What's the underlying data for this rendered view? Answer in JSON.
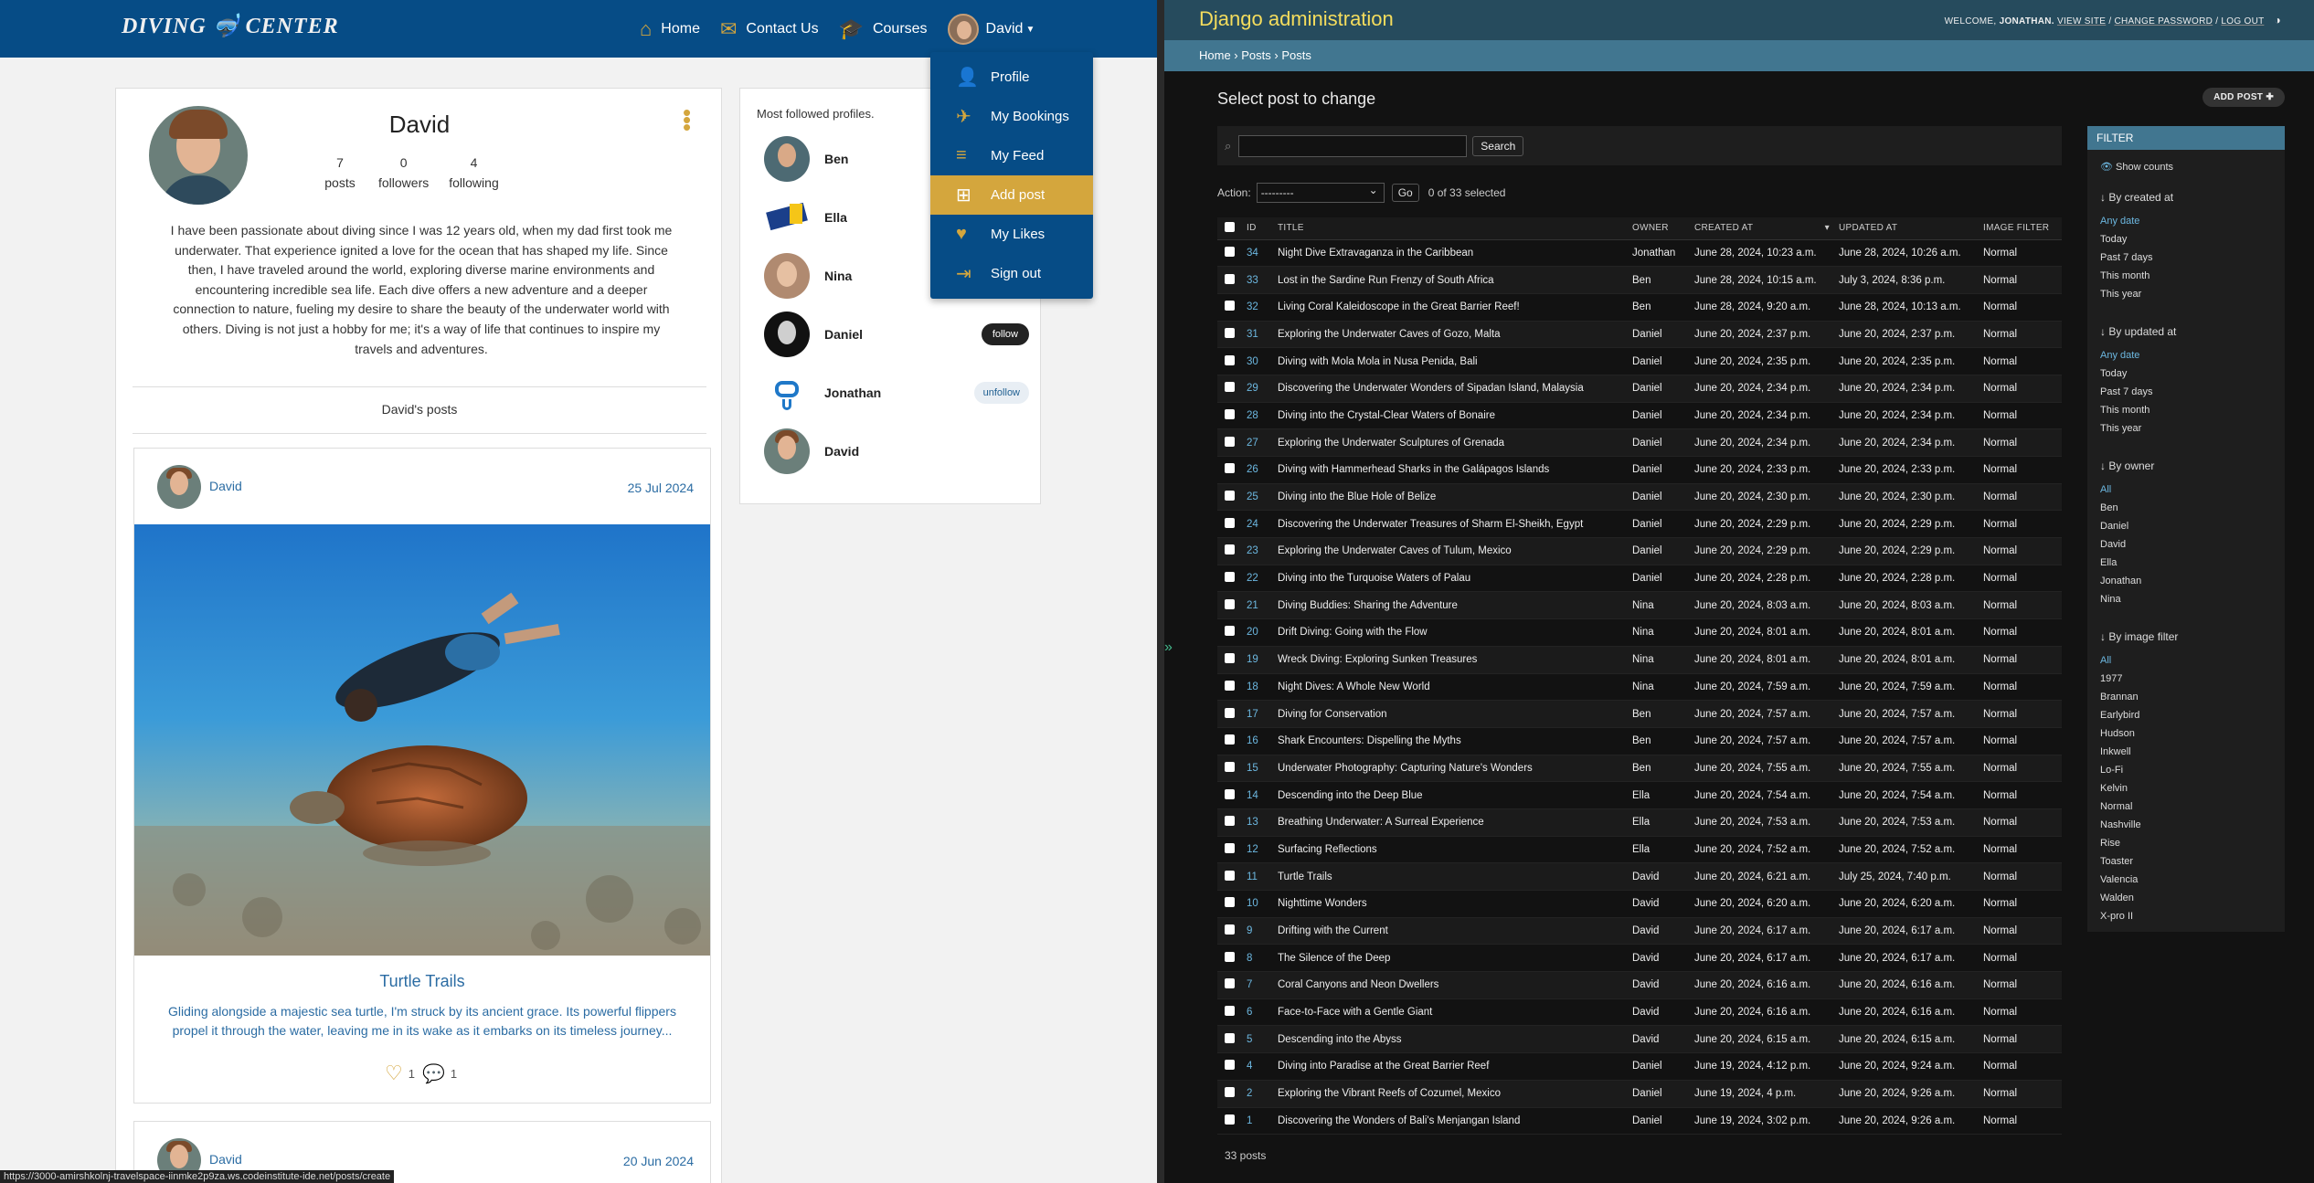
{
  "site": {
    "logo_left": "DIVING",
    "logo_right": "CENTER",
    "nav": [
      {
        "label": "Home",
        "icon": "home-icon"
      },
      {
        "label": "Contact Us",
        "icon": "envelope-icon"
      },
      {
        "label": "Courses",
        "icon": "graduation-cap-icon"
      }
    ],
    "user_label": "David",
    "dropdown": [
      {
        "label": "Profile",
        "icon": "user-icon"
      },
      {
        "label": "My Bookings",
        "icon": "plane-icon"
      },
      {
        "label": "My Feed",
        "icon": "feed-icon"
      },
      {
        "label": "Add post",
        "icon": "plus-square-icon"
      },
      {
        "label": "My Likes",
        "icon": "heart-icon"
      },
      {
        "label": "Sign out",
        "icon": "sign-out-icon"
      }
    ]
  },
  "profile": {
    "name": "David",
    "posts_count": "7",
    "posts_label": "posts",
    "followers_count": "0",
    "followers_label": "followers",
    "following_count": "4",
    "following_label": "following",
    "bio": "I have been passionate about diving since I was 12 years old, when my dad first took me underwater. That experience ignited a love for the ocean that has shaped my life. Since then, I have traveled around the world, exploring diverse marine environments and encountering incredible sea life. Each dive offers a new adventure and a deeper connection to nature, fueling my desire to share the beauty of the underwater world with others. Diving is not just a hobby for me; it's a way of life that continues to inspire my travels and adventures.",
    "posts_heading": "David's posts"
  },
  "posts": [
    {
      "author": "David",
      "date": "25 Jul 2024",
      "title": "Turtle Trails",
      "excerpt": "Gliding alongside a majestic sea turtle, I'm struck by its ancient grace. Its powerful flippers propel it through the water, leaving me in its wake as it embarks on its timeless journey...",
      "likes": "1",
      "comments": "1"
    },
    {
      "author": "David",
      "date": "20 Jun 2024"
    }
  ],
  "followed": {
    "title": "Most followed profiles.",
    "profiles": [
      {
        "name": "Ben",
        "action": ""
      },
      {
        "name": "Ella",
        "action": ""
      },
      {
        "name": "Nina",
        "action": ""
      },
      {
        "name": "Daniel",
        "action": "follow"
      },
      {
        "name": "Jonathan",
        "action": "unfollow"
      },
      {
        "name": "David",
        "action": ""
      }
    ]
  },
  "status_url": "https://3000-amirshkolnj-travelspace-iinmke2p9za.ws.codeinstitute-ide.net/posts/create",
  "admin": {
    "brand": "Django administration",
    "welcome": "WELCOME,",
    "user": "JONATHAN.",
    "links": [
      "VIEW SITE",
      "CHANGE PASSWORD",
      "LOG OUT"
    ],
    "breadcrumb": [
      "Home",
      "Posts",
      "Posts"
    ],
    "title": "Select post to change",
    "add_button": "ADD POST",
    "search_button": "Search",
    "action_label": "Action:",
    "action_value": "---------",
    "go_label": "Go",
    "selected": "0 of 33 selected",
    "columns": [
      "ID",
      "TITLE",
      "OWNER",
      "CREATED AT",
      "UPDATED AT",
      "IMAGE FILTER"
    ],
    "rows": [
      [
        "34",
        "Night Dive Extravaganza in the Caribbean",
        "Jonathan",
        "June 28, 2024, 10:23 a.m.",
        "June 28, 2024, 10:26 a.m.",
        "Normal"
      ],
      [
        "33",
        "Lost in the Sardine Run Frenzy of South Africa",
        "Ben",
        "June 28, 2024, 10:15 a.m.",
        "July 3, 2024, 8:36 p.m.",
        "Normal"
      ],
      [
        "32",
        "Living Coral Kaleidoscope in the Great Barrier Reef!",
        "Ben",
        "June 28, 2024, 9:20 a.m.",
        "June 28, 2024, 10:13 a.m.",
        "Normal"
      ],
      [
        "31",
        "Exploring the Underwater Caves of Gozo, Malta",
        "Daniel",
        "June 20, 2024, 2:37 p.m.",
        "June 20, 2024, 2:37 p.m.",
        "Normal"
      ],
      [
        "30",
        "Diving with Mola Mola in Nusa Penida, Bali",
        "Daniel",
        "June 20, 2024, 2:35 p.m.",
        "June 20, 2024, 2:35 p.m.",
        "Normal"
      ],
      [
        "29",
        "Discovering the Underwater Wonders of Sipadan Island, Malaysia",
        "Daniel",
        "June 20, 2024, 2:34 p.m.",
        "June 20, 2024, 2:34 p.m.",
        "Normal"
      ],
      [
        "28",
        "Diving into the Crystal-Clear Waters of Bonaire",
        "Daniel",
        "June 20, 2024, 2:34 p.m.",
        "June 20, 2024, 2:34 p.m.",
        "Normal"
      ],
      [
        "27",
        "Exploring the Underwater Sculptures of Grenada",
        "Daniel",
        "June 20, 2024, 2:34 p.m.",
        "June 20, 2024, 2:34 p.m.",
        "Normal"
      ],
      [
        "26",
        "Diving with Hammerhead Sharks in the Galápagos Islands",
        "Daniel",
        "June 20, 2024, 2:33 p.m.",
        "June 20, 2024, 2:33 p.m.",
        "Normal"
      ],
      [
        "25",
        "Diving into the Blue Hole of Belize",
        "Daniel",
        "June 20, 2024, 2:30 p.m.",
        "June 20, 2024, 2:30 p.m.",
        "Normal"
      ],
      [
        "24",
        "Discovering the Underwater Treasures of Sharm El-Sheikh, Egypt",
        "Daniel",
        "June 20, 2024, 2:29 p.m.",
        "June 20, 2024, 2:29 p.m.",
        "Normal"
      ],
      [
        "23",
        "Exploring the Underwater Caves of Tulum, Mexico",
        "Daniel",
        "June 20, 2024, 2:29 p.m.",
        "June 20, 2024, 2:29 p.m.",
        "Normal"
      ],
      [
        "22",
        "Diving into the Turquoise Waters of Palau",
        "Daniel",
        "June 20, 2024, 2:28 p.m.",
        "June 20, 2024, 2:28 p.m.",
        "Normal"
      ],
      [
        "21",
        "Diving Buddies: Sharing the Adventure",
        "Nina",
        "June 20, 2024, 8:03 a.m.",
        "June 20, 2024, 8:03 a.m.",
        "Normal"
      ],
      [
        "20",
        "Drift Diving: Going with the Flow",
        "Nina",
        "June 20, 2024, 8:01 a.m.",
        "June 20, 2024, 8:01 a.m.",
        "Normal"
      ],
      [
        "19",
        "Wreck Diving: Exploring Sunken Treasures",
        "Nina",
        "June 20, 2024, 8:01 a.m.",
        "June 20, 2024, 8:01 a.m.",
        "Normal"
      ],
      [
        "18",
        "Night Dives: A Whole New World",
        "Nina",
        "June 20, 2024, 7:59 a.m.",
        "June 20, 2024, 7:59 a.m.",
        "Normal"
      ],
      [
        "17",
        "Diving for Conservation",
        "Ben",
        "June 20, 2024, 7:57 a.m.",
        "June 20, 2024, 7:57 a.m.",
        "Normal"
      ],
      [
        "16",
        "Shark Encounters: Dispelling the Myths",
        "Ben",
        "June 20, 2024, 7:57 a.m.",
        "June 20, 2024, 7:57 a.m.",
        "Normal"
      ],
      [
        "15",
        "Underwater Photography: Capturing Nature's Wonders",
        "Ben",
        "June 20, 2024, 7:55 a.m.",
        "June 20, 2024, 7:55 a.m.",
        "Normal"
      ],
      [
        "14",
        "Descending into the Deep Blue",
        "Ella",
        "June 20, 2024, 7:54 a.m.",
        "June 20, 2024, 7:54 a.m.",
        "Normal"
      ],
      [
        "13",
        "Breathing Underwater: A Surreal Experience",
        "Ella",
        "June 20, 2024, 7:53 a.m.",
        "June 20, 2024, 7:53 a.m.",
        "Normal"
      ],
      [
        "12",
        "Surfacing Reflections",
        "Ella",
        "June 20, 2024, 7:52 a.m.",
        "June 20, 2024, 7:52 a.m.",
        "Normal"
      ],
      [
        "11",
        "Turtle Trails",
        "David",
        "June 20, 2024, 6:21 a.m.",
        "July 25, 2024, 7:40 p.m.",
        "Normal"
      ],
      [
        "10",
        "Nighttime Wonders",
        "David",
        "June 20, 2024, 6:20 a.m.",
        "June 20, 2024, 6:20 a.m.",
        "Normal"
      ],
      [
        "9",
        "Drifting with the Current",
        "David",
        "June 20, 2024, 6:17 a.m.",
        "June 20, 2024, 6:17 a.m.",
        "Normal"
      ],
      [
        "8",
        "The Silence of the Deep",
        "David",
        "June 20, 2024, 6:17 a.m.",
        "June 20, 2024, 6:17 a.m.",
        "Normal"
      ],
      [
        "7",
        "Coral Canyons and Neon Dwellers",
        "David",
        "June 20, 2024, 6:16 a.m.",
        "June 20, 2024, 6:16 a.m.",
        "Normal"
      ],
      [
        "6",
        "Face-to-Face with a Gentle Giant",
        "David",
        "June 20, 2024, 6:16 a.m.",
        "June 20, 2024, 6:16 a.m.",
        "Normal"
      ],
      [
        "5",
        "Descending into the Abyss",
        "David",
        "June 20, 2024, 6:15 a.m.",
        "June 20, 2024, 6:15 a.m.",
        "Normal"
      ],
      [
        "4",
        "Diving into Paradise at the Great Barrier Reef",
        "Daniel",
        "June 19, 2024, 4:12 p.m.",
        "June 20, 2024, 9:24 a.m.",
        "Normal"
      ],
      [
        "2",
        "Exploring the Vibrant Reefs of Cozumel, Mexico",
        "Daniel",
        "June 19, 2024, 4 p.m.",
        "June 20, 2024, 9:26 a.m.",
        "Normal"
      ],
      [
        "1",
        "Discovering the Wonders of Bali's Menjangan Island",
        "Daniel",
        "June 19, 2024, 3:02 p.m.",
        "June 20, 2024, 9:26 a.m.",
        "Normal"
      ]
    ],
    "count_label": "33 posts",
    "filter": {
      "title": "FILTER",
      "show_counts": "Show counts",
      "groups": [
        {
          "heading": "↓ By created at",
          "options": [
            "Any date",
            "Today",
            "Past 7 days",
            "This month",
            "This year"
          ]
        },
        {
          "heading": "↓ By updated at",
          "options": [
            "Any date",
            "Today",
            "Past 7 days",
            "This month",
            "This year"
          ]
        },
        {
          "heading": "↓ By owner",
          "options": [
            "All",
            "Ben",
            "Daniel",
            "David",
            "Ella",
            "Jonathan",
            "Nina"
          ]
        },
        {
          "heading": "↓ By image filter",
          "options": [
            "All",
            "1977",
            "Brannan",
            "Earlybird",
            "Hudson",
            "Inkwell",
            "Lo-Fi",
            "Kelvin",
            "Normal",
            "Nashville",
            "Rise",
            "Toaster",
            "Valencia",
            "Walden",
            "X-pro II"
          ]
        }
      ]
    }
  }
}
